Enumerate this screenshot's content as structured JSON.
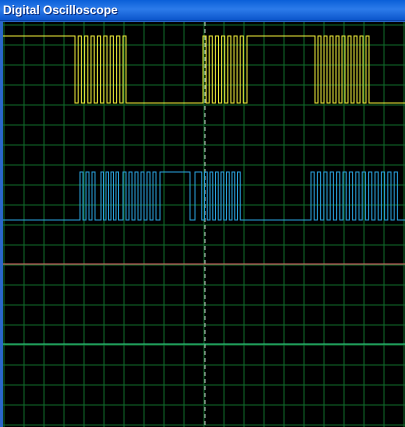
{
  "window": {
    "title": "Digital Oscilloscope"
  },
  "colors": {
    "background": "#000000",
    "grid": "#0f6b2a",
    "cursor": "#c8c8c8",
    "channel_1": "#f2ef3a",
    "channel_2": "#2aa3e0",
    "channel_3": "#e06a6a",
    "channel_4": "#2fd38a"
  },
  "channels": [
    {
      "color_key": "channel_1",
      "kind": "digital"
    },
    {
      "color_key": "channel_2",
      "kind": "digital"
    },
    {
      "color_key": "channel_3",
      "kind": "flat"
    },
    {
      "color_key": "channel_4",
      "kind": "flat"
    }
  ]
}
